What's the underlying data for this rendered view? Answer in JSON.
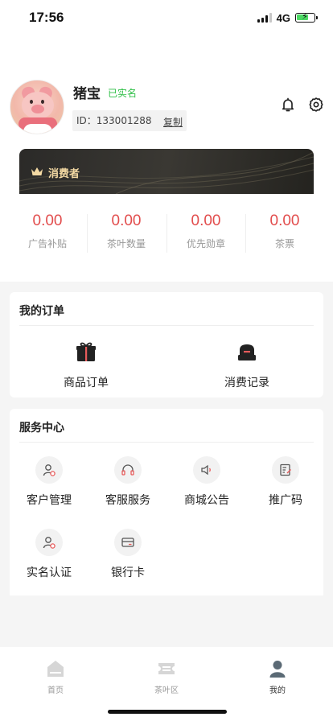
{
  "status_bar": {
    "time": "17:56",
    "network": "4G"
  },
  "profile": {
    "name": "猪宝",
    "verified_badge": "已实名",
    "id_text": "ID：133001288",
    "copy_label": "复制"
  },
  "member_card": {
    "label": "消费者"
  },
  "stats": [
    {
      "value": "0.00",
      "label": "广告补贴"
    },
    {
      "value": "0.00",
      "label": "茶叶数量"
    },
    {
      "value": "0.00",
      "label": "优先勋章"
    },
    {
      "value": "0.00",
      "label": "茶票"
    }
  ],
  "orders": {
    "title": "我的订单",
    "items": [
      {
        "label": "商品订单",
        "icon": "gift-icon"
      },
      {
        "label": "消费记录",
        "icon": "record-icon"
      }
    ]
  },
  "services": {
    "title": "服务中心",
    "items": [
      {
        "label": "客户管理",
        "icon": "customer-icon"
      },
      {
        "label": "客服服务",
        "icon": "headset-icon"
      },
      {
        "label": "商城公告",
        "icon": "speaker-icon"
      },
      {
        "label": "推广码",
        "icon": "promo-code-icon"
      },
      {
        "label": "实名认证",
        "icon": "verify-user-icon"
      },
      {
        "label": "银行卡",
        "icon": "bank-card-icon"
      }
    ]
  },
  "tabbar": {
    "items": [
      {
        "label": "首页",
        "icon": "home-icon"
      },
      {
        "label": "茶叶区",
        "icon": "ticket-icon"
      },
      {
        "label": "我的",
        "icon": "user-icon"
      }
    ],
    "active": "我的"
  },
  "colors": {
    "accent_red": "#e24d4d",
    "verified_green": "#2fbf47",
    "gold": "#f3d9a3"
  }
}
